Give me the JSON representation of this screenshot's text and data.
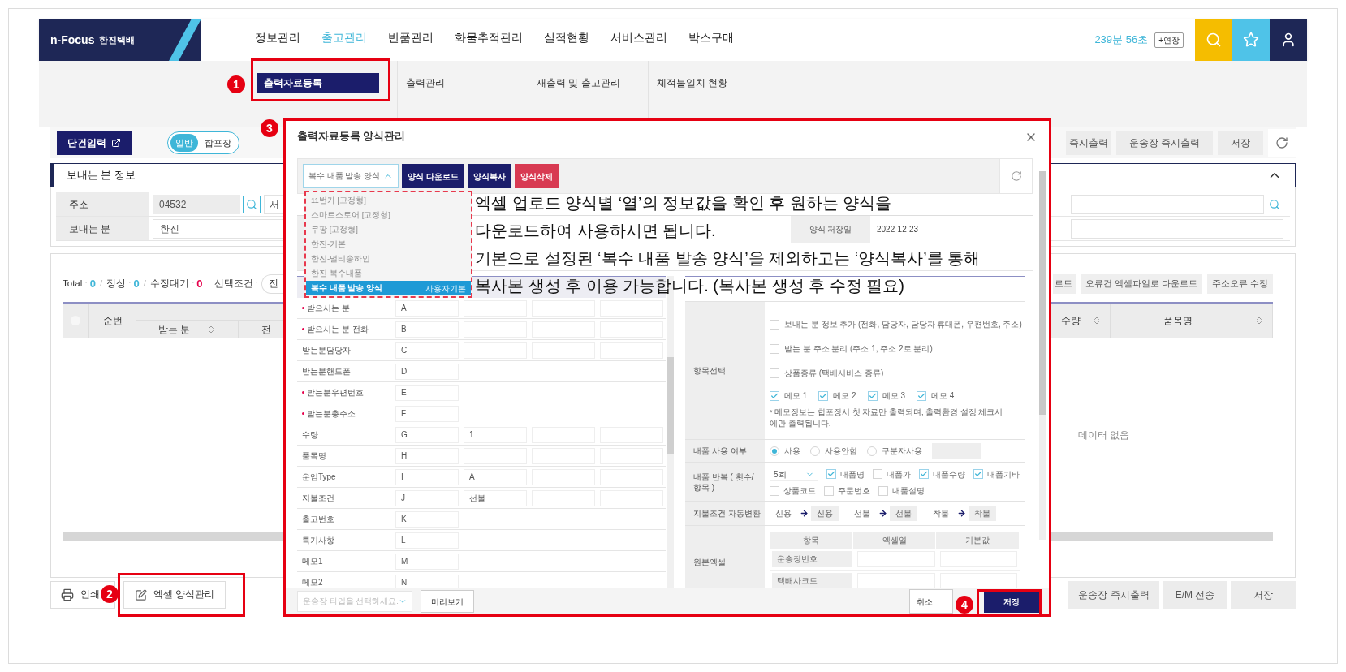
{
  "header": {
    "logo": "n-Focus",
    "brand": "한진택배",
    "nav": [
      {
        "label": "정보관리",
        "selected": false
      },
      {
        "label": "출고관리",
        "selected": true
      },
      {
        "label": "반품관리",
        "selected": false
      },
      {
        "label": "화물추적관리",
        "selected": false
      },
      {
        "label": "실적현황",
        "selected": false
      },
      {
        "label": "서비스관리",
        "selected": false
      },
      {
        "label": "박스구매",
        "selected": false
      }
    ],
    "timer": "239분 56초",
    "extend_button": "+연장"
  },
  "submenu": [
    {
      "label": "출력자료등록",
      "selected": true
    },
    {
      "label": "출력관리",
      "selected": false
    },
    {
      "label": "재출력 및 출고관리",
      "selected": false
    },
    {
      "label": "체적불일치 현황",
      "selected": false
    }
  ],
  "toolbar": {
    "single_entry": "단건입력",
    "toggle": [
      {
        "label": "일반",
        "selected": true
      },
      {
        "label": "합포장",
        "selected": false
      }
    ],
    "right_buttons": [
      "즉시출력",
      "운송장 즉시출력",
      "저장"
    ]
  },
  "sender": {
    "title": "보내는 분 정보",
    "expanded": true,
    "address_label": "주소",
    "zip": "04532",
    "address": "서",
    "name_label": "보내는 분",
    "name": "한진"
  },
  "list": {
    "summary": [
      {
        "label": "Total :",
        "value": "0",
        "color": "#3fb6d8"
      },
      {
        "label": "정상 :",
        "value": "0",
        "color": "#3fb6d8"
      },
      {
        "label": "수정대기 :",
        "value": "0",
        "color": "#e6004c"
      }
    ],
    "summary_separator": "/",
    "select_all_checked": false,
    "filter_label": "선택조건 :",
    "filter_value": "전",
    "buttons": [
      "로드",
      "오류건 엑셀파일로 다운로드",
      "주소오류 수정"
    ],
    "left_columns": [
      "순번",
      "받는 분",
      "전"
    ],
    "right_columns": [
      "수량",
      "품목명"
    ],
    "empty": "데이터 없음"
  },
  "bottom": {
    "left_buttons": [
      {
        "label": "인쇄",
        "kind": "print"
      },
      {
        "label": "엑셀 양식관리",
        "kind": "excel"
      }
    ],
    "right_buttons": [
      "운송장 즉시출력",
      "E/M 전송",
      "저장"
    ]
  },
  "modal": {
    "title": "출력자료등록 양식관리",
    "template_select": {
      "value": "복수 내품 발송 양식",
      "expanded": true
    },
    "buttons": [
      {
        "label": "양식 다운로드",
        "kind": "primary"
      },
      {
        "label": "양식복사",
        "kind": "primary"
      },
      {
        "label": "양식삭제",
        "kind": "danger"
      }
    ],
    "options": [
      {
        "label": "11번가 [고정형]",
        "selected": false
      },
      {
        "label": "스마트스토어 [고정형]",
        "selected": false
      },
      {
        "label": "쿠팡 [고정형]",
        "selected": false
      },
      {
        "label": "한진-기본",
        "selected": false
      },
      {
        "label": "한진-멀티송하인",
        "selected": false
      },
      {
        "label": "한진-복수내품",
        "selected": false
      },
      {
        "label": "복수 내품 발송 양식",
        "tag": "사용자기본",
        "selected": true
      }
    ],
    "saved_date_label": "양식 저장일",
    "saved_date": "2022-12-23",
    "fields": [
      {
        "label": "받으시는 분",
        "required": true,
        "column": "A",
        "kind": "full"
      },
      {
        "label": "받으시는 분 전화",
        "required": true,
        "column": "B",
        "kind": "full"
      },
      {
        "label": "받는분담당자",
        "required": false,
        "column": "C",
        "kind": "full"
      },
      {
        "label": "받는분핸드폰",
        "required": false,
        "column": "D",
        "kind": "short"
      },
      {
        "label": "받는분우편번호",
        "required": true,
        "column": "E",
        "kind": "short"
      },
      {
        "label": "받는분총주소",
        "required": true,
        "column": "F",
        "kind": "short"
      },
      {
        "label": "수량",
        "required": false,
        "column": "G",
        "default": "1",
        "kind": "full"
      },
      {
        "label": "품목명",
        "required": false,
        "column": "H",
        "kind": "full"
      },
      {
        "label": "운임Type",
        "required": false,
        "column": "I",
        "default": "A",
        "kind": "full"
      },
      {
        "label": "지불조건",
        "required": false,
        "column": "J",
        "default": "선불",
        "kind": "full"
      },
      {
        "label": "출고번호",
        "required": false,
        "column": "K",
        "kind": "short"
      },
      {
        "label": "특기사항",
        "required": false,
        "column": "L",
        "kind": "short"
      },
      {
        "label": "메모1",
        "required": false,
        "column": "M",
        "kind": "short"
      },
      {
        "label": "메모2",
        "required": false,
        "column": "N",
        "kind": "short"
      }
    ],
    "item_select": {
      "label": "항목선택",
      "options": [
        {
          "label": "보내는 분 정보 추가 (전화, 담당자, 담당자 휴대폰, 우편번호, 주소)",
          "checked": false
        },
        {
          "label": "받는 분 주소 분리 (주소 1, 주소 2로 분리)",
          "checked": false
        },
        {
          "label": "상품종류 (택배서비스 종류)",
          "checked": false
        }
      ],
      "memos": [
        {
          "label": "메모 1",
          "checked": true
        },
        {
          "label": "메모 2",
          "checked": true
        },
        {
          "label": "메모 3",
          "checked": true
        },
        {
          "label": "메모 4",
          "checked": true
        }
      ],
      "note": "* 메모정보는 합포장시 첫 자료만 출력되며, 출력환경 설정 체크시에만 출력됩니다."
    },
    "inner_use": {
      "label": "내품 사용 여부",
      "radios": [
        {
          "label": "사용",
          "selected": true
        },
        {
          "label": "사용안함",
          "selected": false
        },
        {
          "label": "구분자사용",
          "selected": false
        }
      ]
    },
    "repeat": {
      "label": "내품 반복 ( 횟수/항목 )",
      "count": "5회",
      "options": [
        {
          "label": "내품명",
          "checked": true
        },
        {
          "label": "내품가",
          "checked": false
        },
        {
          "label": "내품수량",
          "checked": true
        },
        {
          "label": "내품기타",
          "checked": true
        },
        {
          "label": "상품코드",
          "checked": false
        },
        {
          "label": "주문번호",
          "checked": false
        },
        {
          "label": "내품설명",
          "checked": false
        }
      ]
    },
    "payment": {
      "label": "지불조건 자동변환",
      "pairs": [
        {
          "from": "신용",
          "to": "신용"
        },
        {
          "from": "선불",
          "to": "선불"
        },
        {
          "from": "착불",
          "to": "착불"
        }
      ]
    },
    "original_excel": {
      "label": "원본엑셀",
      "columns": [
        "항목",
        "엑셀열",
        "기본값"
      ],
      "rows": [
        "운송장번호",
        "택배사코드"
      ]
    },
    "waybill_placeholder": "운송장 타입을 선택하세요.",
    "preview": "미리보기",
    "cancel": "취소",
    "save": "저장"
  },
  "callout_lines": [
    "엑셀 업로드 양식별 ‘열’의 정보값을 확인 후 원하는 양식을",
    "다운로드하여 사용하시면 됩니다.",
    "기본으로 설정된 ‘복수 내품 발송 양식’을 제외하고는 ‘양식복사’를 통해",
    "복사본 생성 후 이용 가능합니다. (복사본 생성 후 수정 필요)"
  ],
  "badges": [
    "1",
    "2",
    "3",
    "4"
  ]
}
